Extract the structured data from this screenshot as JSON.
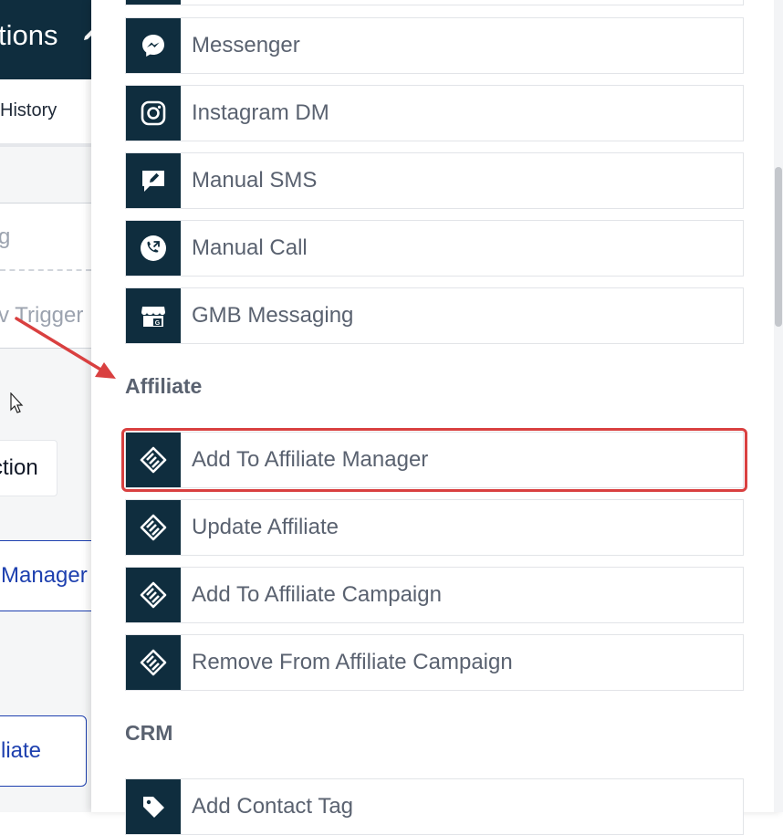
{
  "background": {
    "header_title_fragment": "tions",
    "tab_history": "History",
    "trigger_placeholder_fragment": "g",
    "add_trigger_fragment": "v Trigger",
    "action_button_fragment": "ction",
    "manager_fragment": "Manager",
    "affiliate_fragment": "liate"
  },
  "panel": {
    "messaging_items": [
      {
        "label": "Messenger",
        "icon": "messenger-icon"
      },
      {
        "label": "Instagram DM",
        "icon": "instagram-icon"
      },
      {
        "label": "Manual SMS",
        "icon": "manual-sms-icon"
      },
      {
        "label": "Manual Call",
        "icon": "phone-call-icon"
      },
      {
        "label": "GMB Messaging",
        "icon": "gmb-store-icon"
      }
    ],
    "affiliate_section": {
      "title": "Affiliate",
      "items": [
        {
          "label": "Add To Affiliate Manager",
          "icon": "handshake-icon",
          "highlighted": true
        },
        {
          "label": "Update Affiliate",
          "icon": "handshake-icon"
        },
        {
          "label": "Add To Affiliate Campaign",
          "icon": "handshake-icon"
        },
        {
          "label": "Remove From Affiliate Campaign",
          "icon": "handshake-icon"
        }
      ]
    },
    "crm_section": {
      "title": "CRM",
      "items": [
        {
          "label": "Add Contact Tag",
          "icon": "tag-icon"
        }
      ]
    }
  },
  "colors": {
    "icon_tile": "#0f2d3e",
    "highlight": "#d94040",
    "annotation_arrow": "#d94040",
    "link_blue": "#1e40af"
  }
}
